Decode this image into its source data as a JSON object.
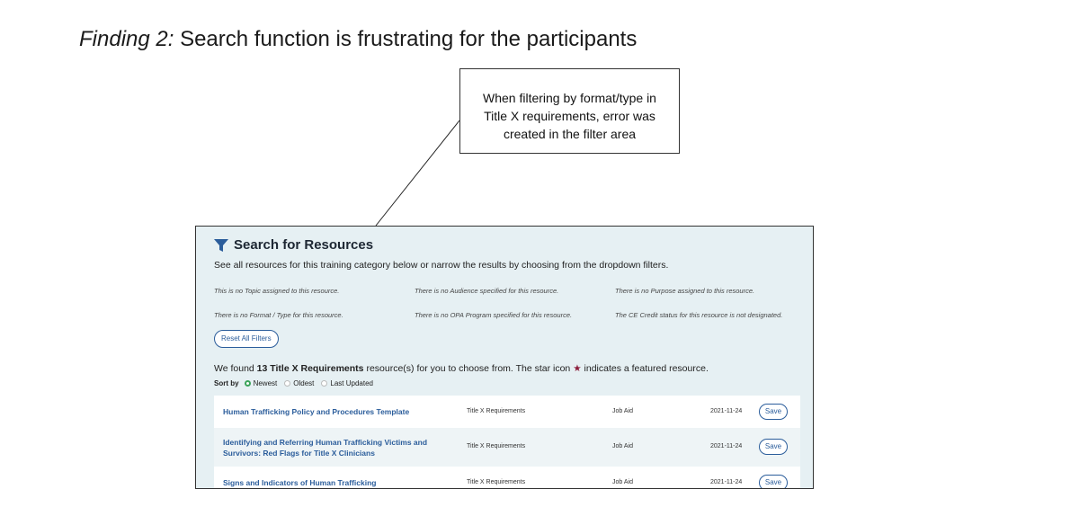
{
  "slide": {
    "title_emphasis": "Finding 2:",
    "title_rest": " Search function is frustrating for the participants"
  },
  "callout": {
    "text": "When filtering by format/type in Title X requirements, error was created in the filter area"
  },
  "screenshot": {
    "heading": "Search for Resources",
    "description": "See all resources for this training category below or narrow the results by choosing from the dropdown filters.",
    "filters": [
      "This is no Topic assigned to this resource.",
      "There is no Audience specified for this resource.",
      "There is no Purpose assigned to this resource.",
      "There is no Format / Type for this resource.",
      "There is no OPA Program specified for this resource.",
      "The CE Credit status for this resource is not designated."
    ],
    "reset_label": "Reset All Filters",
    "found": {
      "prefix": "We found ",
      "bold": "13 Title X Requirements",
      "suffix": " resource(s) for you to choose from. The star icon ",
      "star": "★",
      "end": " indicates a featured resource."
    },
    "sort": {
      "label": "Sort by",
      "options": [
        "Newest",
        "Oldest",
        "Last Updated"
      ],
      "selected": "Newest"
    },
    "rows": [
      {
        "title": "Human Trafficking Policy and Procedures Template",
        "category": "Title X Requirements",
        "format": "Job Aid",
        "date": "2021-11-24",
        "action": "Save"
      },
      {
        "title": "Identifying and Referring Human Trafficking Victims and Survivors: Red Flags for Title X Clinicians",
        "category": "Title X Requirements",
        "format": "Job Aid",
        "date": "2021-11-24",
        "action": "Save"
      },
      {
        "title": "Signs and Indicators of Human Trafficking",
        "category": "Title X Requirements",
        "format": "Job Aid",
        "date": "2021-11-24",
        "action": "Save"
      }
    ],
    "colors": {
      "panel_bg": "#e6f0f3",
      "link": "#2b5d9b",
      "star": "#8b1d3b",
      "radio_selected": "#3aa35a"
    }
  }
}
